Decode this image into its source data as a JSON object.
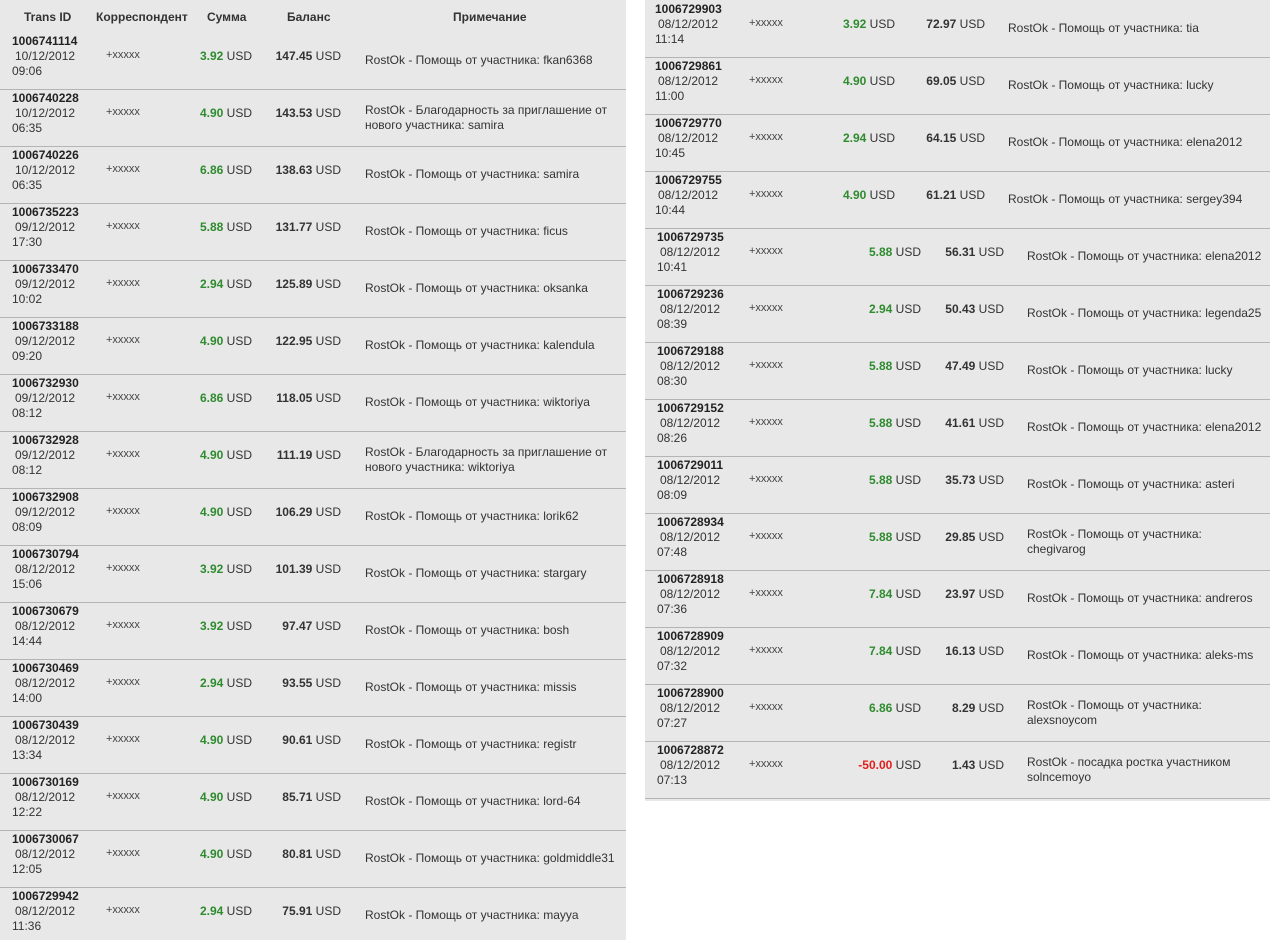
{
  "header": {
    "trans_id": "Trans ID",
    "correspondent": "Корреспондент",
    "amount": "Сумма",
    "balance": "Баланс",
    "note": "Примечание"
  },
  "colors": {
    "positive": "#2e8b2e",
    "negative": "#e0201c",
    "panel": "#e8e8e8"
  },
  "left_rows": [
    {
      "id": "1006741114",
      "date": "10/12/2012",
      "time": "09:06",
      "corr": "+xxxxx",
      "amount": "3.92",
      "currency": "USD",
      "balance": "147.45",
      "note": "RostOk - Помощь от участника: fkan6368"
    },
    {
      "id": "1006740228",
      "date": "10/12/2012",
      "time": "06:35",
      "corr": "+xxxxx",
      "amount": "4.90",
      "currency": "USD",
      "balance": "143.53",
      "note": "RostOk - Благодарность за приглашение от нового участника: samira"
    },
    {
      "id": "1006740226",
      "date": "10/12/2012",
      "time": "06:35",
      "corr": "+xxxxx",
      "amount": "6.86",
      "currency": "USD",
      "balance": "138.63",
      "note": "RostOk - Помощь от участника: samira"
    },
    {
      "id": "1006735223",
      "date": "09/12/2012",
      "time": "17:30",
      "corr": "+xxxxx",
      "amount": "5.88",
      "currency": "USD",
      "balance": "131.77",
      "note": "RostOk - Помощь от участника: ficus"
    },
    {
      "id": "1006733470",
      "date": "09/12/2012",
      "time": "10:02",
      "corr": "+xxxxx",
      "amount": "2.94",
      "currency": "USD",
      "balance": "125.89",
      "note": "RostOk - Помощь от участника: oksanka"
    },
    {
      "id": "1006733188",
      "date": "09/12/2012",
      "time": "09:20",
      "corr": "+xxxxx",
      "amount": "4.90",
      "currency": "USD",
      "balance": "122.95",
      "note": "RostOk - Помощь от участника: kalendula"
    },
    {
      "id": "1006732930",
      "date": "09/12/2012",
      "time": "08:12",
      "corr": "+xxxxx",
      "amount": "6.86",
      "currency": "USD",
      "balance": "118.05",
      "note": "RostOk - Помощь от участника: wiktoriya"
    },
    {
      "id": "1006732928",
      "date": "09/12/2012",
      "time": "08:12",
      "corr": "+xxxxx",
      "amount": "4.90",
      "currency": "USD",
      "balance": "111.19",
      "note": "RostOk - Благодарность за приглашение от нового участника: wiktoriya"
    },
    {
      "id": "1006732908",
      "date": "09/12/2012",
      "time": "08:09",
      "corr": "+xxxxx",
      "amount": "4.90",
      "currency": "USD",
      "balance": "106.29",
      "note": "RostOk - Помощь от участника: lorik62"
    },
    {
      "id": "1006730794",
      "date": "08/12/2012",
      "time": "15:06",
      "corr": "+xxxxx",
      "amount": "3.92",
      "currency": "USD",
      "balance": "101.39",
      "note": "RostOk - Помощь от участника: stargary"
    },
    {
      "id": "1006730679",
      "date": "08/12/2012",
      "time": "14:44",
      "corr": "+xxxxx",
      "amount": "3.92",
      "currency": "USD",
      "balance": "97.47",
      "note": "RostOk - Помощь от участника: bosh"
    },
    {
      "id": "1006730469",
      "date": "08/12/2012",
      "time": "14:00",
      "corr": "+xxxxx",
      "amount": "2.94",
      "currency": "USD",
      "balance": "93.55",
      "note": "RostOk - Помощь от участника: missis"
    },
    {
      "id": "1006730439",
      "date": "08/12/2012",
      "time": "13:34",
      "corr": "+xxxxx",
      "amount": "4.90",
      "currency": "USD",
      "balance": "90.61",
      "note": "RostOk - Помощь от участника: registr"
    },
    {
      "id": "1006730169",
      "date": "08/12/2012",
      "time": "12:22",
      "corr": "+xxxxx",
      "amount": "4.90",
      "currency": "USD",
      "balance": "85.71",
      "note": "RostOk - Помощь от участника: lord-64"
    },
    {
      "id": "1006730067",
      "date": "08/12/2012",
      "time": "12:05",
      "corr": "+xxxxx",
      "amount": "4.90",
      "currency": "USD",
      "balance": "80.81",
      "note": "RostOk - Помощь от участника: goldmiddle31"
    },
    {
      "id": "1006729942",
      "date": "08/12/2012",
      "time": "11:36",
      "corr": "+xxxxx",
      "amount": "2.94",
      "currency": "USD",
      "balance": "75.91",
      "note": "RostOk - Помощь от участника: mayya"
    }
  ],
  "right_rows": [
    {
      "id": "1006729903",
      "date": "08/12/2012",
      "time": "11:14",
      "corr": "+xxxxx",
      "amount": "3.92",
      "currency": "USD",
      "balance": "72.97",
      "note": "RostOk - Помощь от участника: tia"
    },
    {
      "id": "1006729861",
      "date": "08/12/2012",
      "time": "11:00",
      "corr": "+xxxxx",
      "amount": "4.90",
      "currency": "USD",
      "balance": "69.05",
      "note": "RostOk - Помощь от участника: lucky"
    },
    {
      "id": "1006729770",
      "date": "08/12/2012",
      "time": "10:45",
      "corr": "+xxxxx",
      "amount": "2.94",
      "currency": "USD",
      "balance": "64.15",
      "note": "RostOk - Помощь от участника: elena2012"
    },
    {
      "id": "1006729755",
      "date": "08/12/2012",
      "time": "10:44",
      "corr": "+xxxxx",
      "amount": "4.90",
      "currency": "USD",
      "balance": "61.21",
      "note": "RostOk - Помощь от участника: sergey394"
    },
    {
      "id": "1006729735",
      "date": "08/12/2012",
      "time": "10:41",
      "corr": "+xxxxx",
      "amount": "5.88",
      "currency": "USD",
      "balance": "56.31",
      "note": "RostOk - Помощь от участника: elena2012"
    },
    {
      "id": "1006729236",
      "date": "08/12/2012",
      "time": "08:39",
      "corr": "+xxxxx",
      "amount": "2.94",
      "currency": "USD",
      "balance": "50.43",
      "note": "RostOk - Помощь от участника: legenda25"
    },
    {
      "id": "1006729188",
      "date": "08/12/2012",
      "time": "08:30",
      "corr": "+xxxxx",
      "amount": "5.88",
      "currency": "USD",
      "balance": "47.49",
      "note": "RostOk - Помощь от участника: lucky"
    },
    {
      "id": "1006729152",
      "date": "08/12/2012",
      "time": "08:26",
      "corr": "+xxxxx",
      "amount": "5.88",
      "currency": "USD",
      "balance": "41.61",
      "note": "RostOk - Помощь от участника: elena2012"
    },
    {
      "id": "1006729011",
      "date": "08/12/2012",
      "time": "08:09",
      "corr": "+xxxxx",
      "amount": "5.88",
      "currency": "USD",
      "balance": "35.73",
      "note": "RostOk - Помощь от участника: asteri"
    },
    {
      "id": "1006728934",
      "date": "08/12/2012",
      "time": "07:48",
      "corr": "+xxxxx",
      "amount": "5.88",
      "currency": "USD",
      "balance": "29.85",
      "note": "RostOk - Помощь от участника: chegivarog"
    },
    {
      "id": "1006728918",
      "date": "08/12/2012",
      "time": "07:36",
      "corr": "+xxxxx",
      "amount": "7.84",
      "currency": "USD",
      "balance": "23.97",
      "note": "RostOk - Помощь от участника: andreros"
    },
    {
      "id": "1006728909",
      "date": "08/12/2012",
      "time": "07:32",
      "corr": "+xxxxx",
      "amount": "7.84",
      "currency": "USD",
      "balance": "16.13",
      "note": "RostOk - Помощь от участника: aleks-ms"
    },
    {
      "id": "1006728900",
      "date": "08/12/2012",
      "time": "07:27",
      "corr": "+xxxxx",
      "amount": "6.86",
      "currency": "USD",
      "balance": "8.29",
      "note": "RostOk - Помощь от участника: alexsnoycom"
    },
    {
      "id": "1006728872",
      "date": "08/12/2012",
      "time": "07:13",
      "corr": "+xxxxx",
      "amount": "-50.00",
      "currency": "USD",
      "balance": "1.43",
      "note": "RostOk - посадка ростка участником solncemoyo"
    }
  ]
}
